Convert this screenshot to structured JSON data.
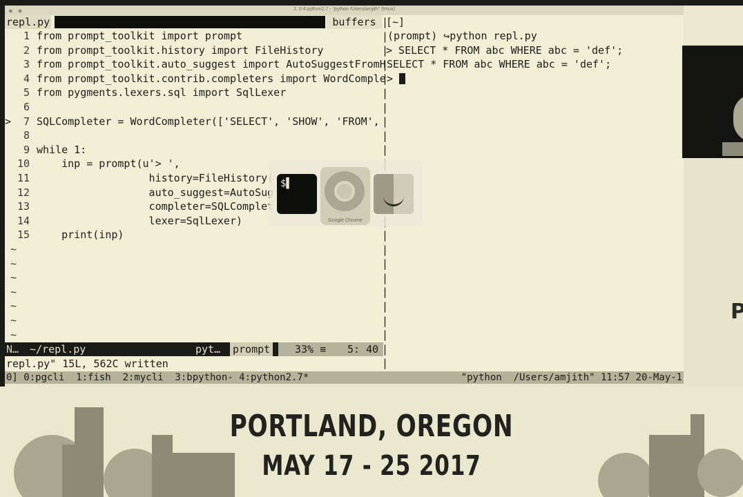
{
  "window": {
    "title": "2. 0:4:python2.7 - \"python /Users/amjith\" (tmux)"
  },
  "editor": {
    "tab_active": "repl.py",
    "buffers_label": "buffers",
    "lines": [
      {
        "num": "1",
        "text": "from prompt_toolkit import prompt"
      },
      {
        "num": "2",
        "text": "from prompt_toolkit.history import FileHistory"
      },
      {
        "num": "3",
        "text": "from prompt_toolkit.auto_suggest import AutoSuggestFromH"
      },
      {
        "num": "4",
        "text": "from prompt_toolkit.contrib.completers import WordComple"
      },
      {
        "num": "5",
        "text": "from pygments.lexers.sql import SqlLexer"
      },
      {
        "num": "6",
        "text": ""
      },
      {
        "num": "7",
        "text": "SQLCompleter = WordCompleter(['SELECT', 'SHOW', 'FROM',"
      },
      {
        "num": "8",
        "text": ""
      },
      {
        "num": "9",
        "text": "while 1:"
      },
      {
        "num": "10",
        "text": "    inp = prompt(u'> ',"
      },
      {
        "num": "11",
        "text": "                  history=FileHistory("
      },
      {
        "num": "12",
        "text": "                  auto_suggest=AutoSug"
      },
      {
        "num": "13",
        "text": "                  completer=SQLComplet"
      },
      {
        "num": "14",
        "text": "                  lexer=SqlLexer)"
      },
      {
        "num": "15",
        "text": "    print(inp)"
      }
    ],
    "current_line_marker": ">",
    "tilde": "~",
    "status": {
      "mode": "N…",
      "file": "~/repl.py",
      "filetype": "pyt…",
      "function": "prompt",
      "percent": "33% ≡",
      "position": "5: 40"
    },
    "command_line": "repl.py\" 15L, 562C written"
  },
  "shell": {
    "header": "[~]",
    "prompt_line": "(prompt) ↪python repl.py",
    "input_line": "> SELECT * FROM abc WHERE abc = 'def';",
    "output_line": "SELECT * FROM abc WHERE abc = 'def';",
    "prompt": "> "
  },
  "tmux": {
    "windows": "0] 0:pgcli  1:fish  2:mycli  3:bpython- 4:python2.7*",
    "right": "\"python  /Users/amjith\" 11:57 20-May-1"
  },
  "app_switcher": {
    "terminal_glyph": "$▌",
    "chrome_label": "Google Chrome"
  },
  "banner": {
    "line1": "PORTLAND, OREGON",
    "line2": "MAY 17 - 25 2017",
    "side_logo": "P"
  },
  "colors": {
    "background": "#e9e7cc",
    "terminal_bg": "#f0eed4",
    "status_bg": "#1b1b18",
    "tmux_bg": "#b4b299"
  }
}
